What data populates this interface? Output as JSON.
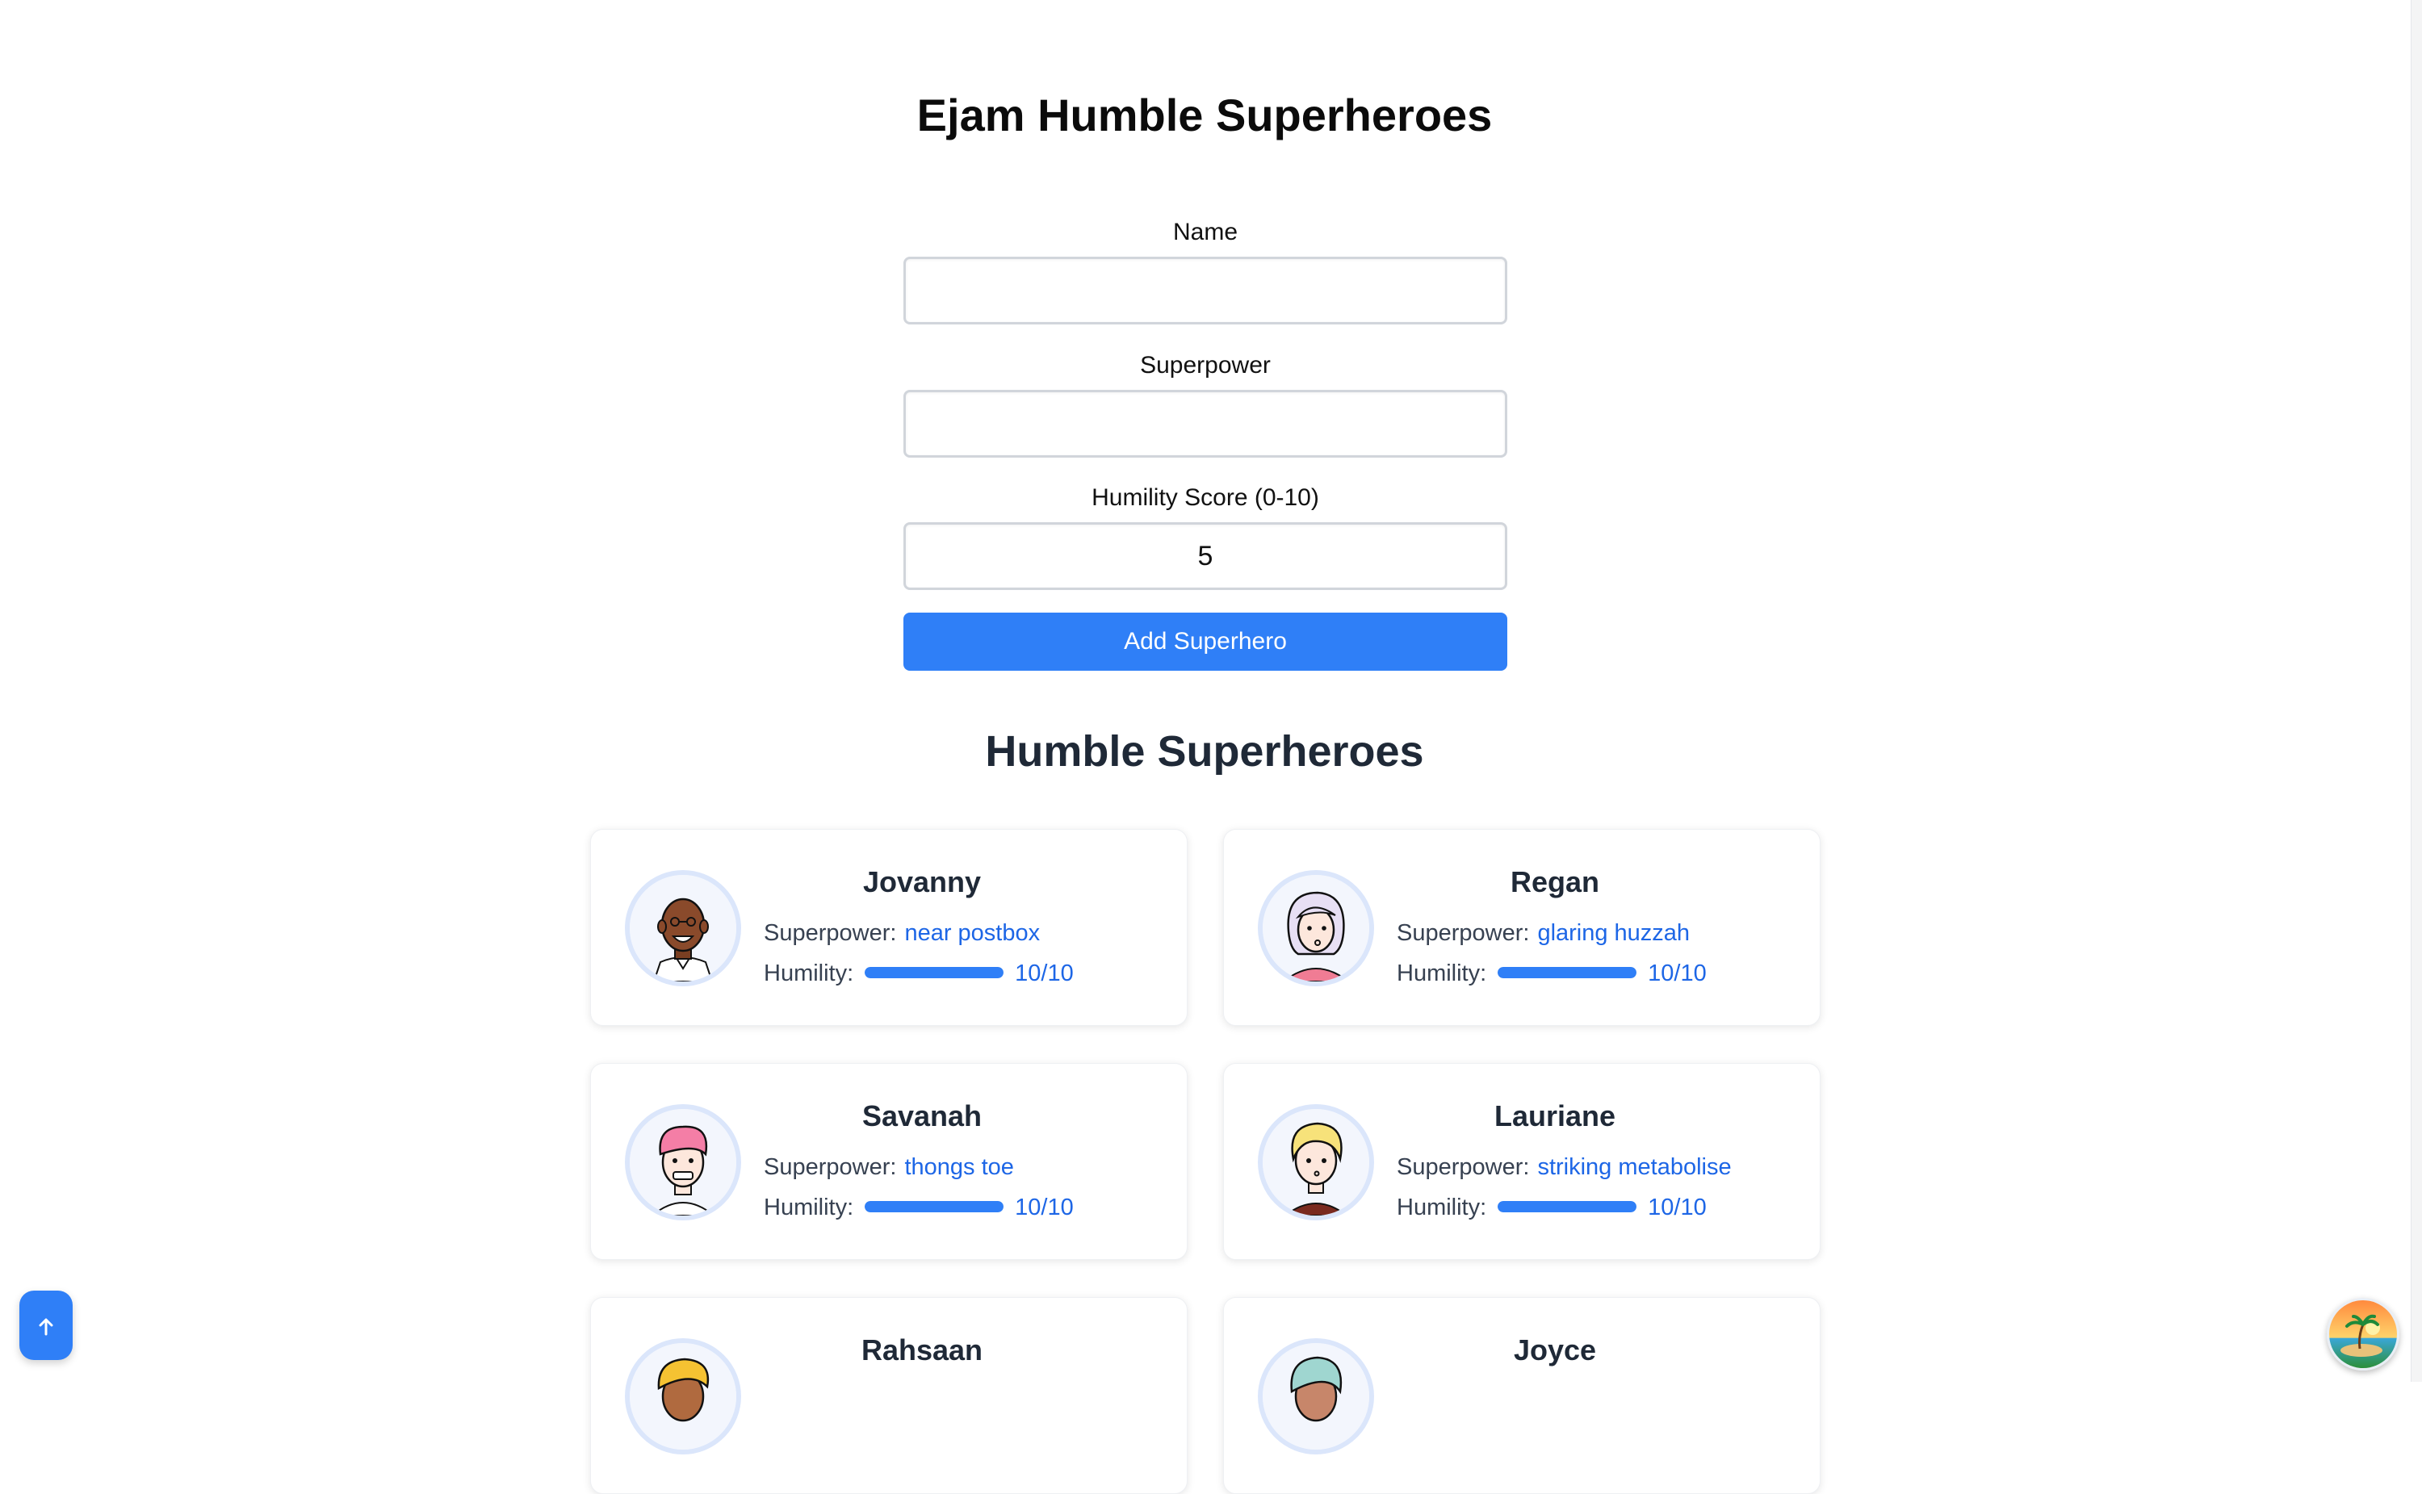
{
  "page": {
    "title": "Ejam Humble Superheroes"
  },
  "form": {
    "name_label": "Name",
    "name_value": "",
    "superpower_label": "Superpower",
    "superpower_value": "",
    "humility_label": "Humility Score (0-10)",
    "humility_value": "5",
    "submit_label": "Add Superhero"
  },
  "list": {
    "title": "Humble Superheroes",
    "superpower_label": "Superpower:",
    "humility_label": "Humility:",
    "heroes": [
      {
        "name": "Jovanny",
        "superpower": "near postbox",
        "humility": 10,
        "score_text": "10/10"
      },
      {
        "name": "Regan",
        "superpower": "glaring huzzah",
        "humility": 10,
        "score_text": "10/10"
      },
      {
        "name": "Savanah",
        "superpower": "thongs toe",
        "humility": 10,
        "score_text": "10/10"
      },
      {
        "name": "Lauriane",
        "superpower": "striking metabolise",
        "humility": 10,
        "score_text": "10/10"
      },
      {
        "name": "Rahsaan"
      },
      {
        "name": "Joyce"
      }
    ]
  },
  "colors": {
    "accent": "#2f7ff7",
    "link": "#1d66e6",
    "avatar_ring": "#dbe6fb"
  },
  "icons": {
    "scroll_top": "arrow-up-icon",
    "theme": "island-sunset-icon"
  }
}
